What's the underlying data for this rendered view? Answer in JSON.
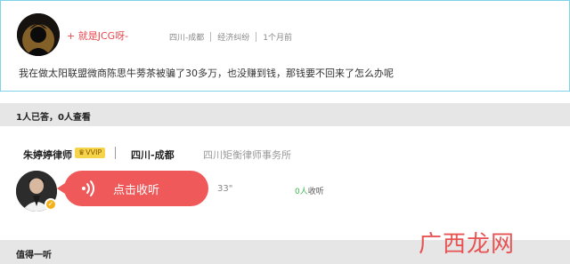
{
  "question": {
    "asker_name": "+ 就是JCG呀-",
    "location": "四川-成都",
    "category": "经济纠纷",
    "time": "1个月前",
    "text": "我在做太阳联盟微商陈思牛蒡茶被骗了30多万，也没赚到钱，那钱要不回来了怎么办呢"
  },
  "stats": {
    "summary": "1人已答，0人查看"
  },
  "answer": {
    "lawyer_name": "朱婷婷律师",
    "vip_label": "VVIP",
    "location": "四川-成都",
    "firm": "四川矩衡律师事务所",
    "listen_label": "点击收听",
    "duration": "33\"",
    "listen_count": "0人",
    "listen_suffix": "收听"
  },
  "section": {
    "worth_title": "值得一听"
  },
  "watermark": "广西龙网",
  "colors": {
    "accent": "#f0595a",
    "border": "#7fd3e6",
    "listen_count": "#3fb950",
    "asker_name": "#e8484f"
  }
}
